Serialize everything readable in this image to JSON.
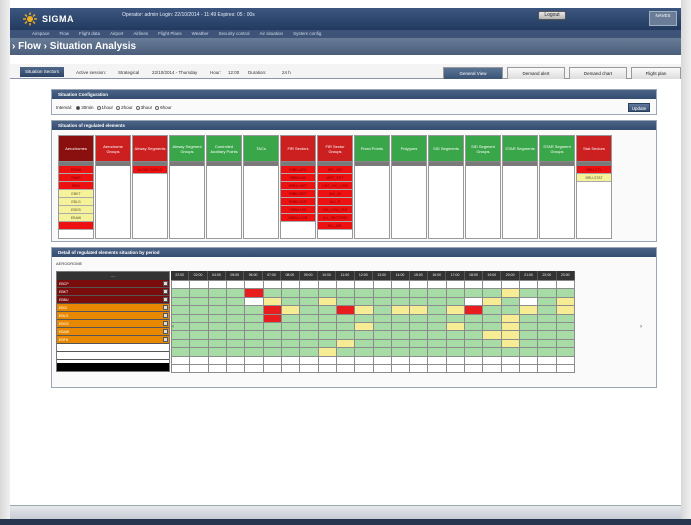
{
  "app": {
    "name": "SIGMA",
    "brand": "NAVES"
  },
  "session": {
    "text": "Operator: admin  Login: 22/10/2014 - 11:49  Expires: 05 : 00s"
  },
  "topbar": {
    "logout": "Logout"
  },
  "menu": [
    "Airspace",
    "Flow",
    "Flight data",
    "Airport",
    "Airlines",
    "Flight Plans",
    "Weather",
    "Security control",
    "Air situation",
    "System config"
  ],
  "page_title": "› Flow › Situation Analysis",
  "context": {
    "button": "Situation Sectors",
    "items": [
      "Active session:",
      "Strategical",
      "22/10/2014 - Thursday",
      "Hour:",
      "12:00",
      "Duration:",
      "24 h"
    ]
  },
  "tabs": [
    {
      "label": "General View",
      "active": true
    },
    {
      "label": "Demand alert",
      "active": false
    },
    {
      "label": "Demand chart",
      "active": false
    },
    {
      "label": "Flight plan",
      "active": false
    }
  ],
  "config": {
    "title": "Situation Configuration",
    "interval_label": "Interval:",
    "options": [
      {
        "label": "30min",
        "selected": true
      },
      {
        "label": "1hour",
        "selected": false
      },
      {
        "label": "2hour",
        "selected": false
      },
      {
        "label": "3hour",
        "selected": false
      },
      {
        "label": "6hour",
        "selected": false
      }
    ],
    "update": "Update"
  },
  "regulated": {
    "title": "Situation of regulated elements",
    "columns": [
      {
        "label": "Aerodromes",
        "color": "dred",
        "cells": [
          [
            "EBAW",
            "cr"
          ],
          [
            "EBAP",
            "cr"
          ],
          [
            "EBCI",
            "cr"
          ],
          [
            "EBKT",
            "cy"
          ],
          [
            "EBLG",
            "cy"
          ],
          [
            "EBOS",
            "cy"
          ],
          [
            "EBAW",
            "cy"
          ],
          [
            "",
            "cr"
          ]
        ]
      },
      {
        "label": "Aerodrome Groups",
        "color": "red",
        "cells": []
      },
      {
        "label": "Airway Segments",
        "color": "red",
        "cells": [
          [
            "ALGAT-GOSLO",
            "cr"
          ]
        ]
      },
      {
        "label": "Airway Segment Groups",
        "color": "grn",
        "cells": []
      },
      {
        "label": "Controlled Auxiliary Points",
        "color": "grn",
        "cells": []
      },
      {
        "label": "TACs",
        "color": "grn",
        "cells": []
      },
      {
        "label": "FIR Sectors",
        "color": "red",
        "cells": [
          [
            "EBBU-ARL",
            "cr"
          ],
          [
            "EBBU-NIC",
            "cr"
          ],
          [
            "EBBU-WST",
            "cr"
          ],
          [
            "EBBU-EST",
            "cr"
          ],
          [
            "EBBU-CNT",
            "cr"
          ],
          [
            "EBBU-HIG",
            "cr"
          ],
          [
            "EBBU-LOW",
            "cr"
          ]
        ]
      },
      {
        "label": "FIR Sector Groups",
        "color": "red",
        "cells": [
          [
            "ARL_NIC",
            "cr"
          ],
          [
            "WST_EST",
            "cr"
          ],
          [
            "CNT_HIG_LOW",
            "cr"
          ],
          [
            "ALL_W",
            "cr"
          ],
          [
            "ALL_E",
            "cr"
          ],
          [
            "HIG_LOW_CNT",
            "cr"
          ],
          [
            "ALL_SECTORS",
            "cr"
          ],
          [
            "NIC_ARL",
            "cr"
          ]
        ]
      },
      {
        "label": "Fixed Points",
        "color": "grn",
        "cells": []
      },
      {
        "label": "Polygons",
        "color": "grn",
        "cells": []
      },
      {
        "label": "SID Segments",
        "color": "grn",
        "cells": []
      },
      {
        "label": "SID Segment Groups",
        "color": "grn",
        "cells": []
      },
      {
        "label": "STAR Segments",
        "color": "grn",
        "cells": []
      },
      {
        "label": "STAR Segment Groups",
        "color": "grn",
        "cells": []
      },
      {
        "label": "Stat Sectors",
        "color": "red",
        "cells": [
          [
            "BRU-CTL",
            "cr"
          ],
          [
            "BRU-STAT",
            "cy"
          ]
        ]
      }
    ]
  },
  "detail": {
    "title": "Detail of regulated elements situation by period",
    "subtitle": "AERODROME",
    "group_header": "---",
    "times": [
      "22:00",
      "02:00",
      "04:00",
      "05:00",
      "06:00",
      "07:00",
      "08:00",
      "09:00",
      "10:00",
      "11:00",
      "12:00",
      "13:00",
      "14:00",
      "15:00",
      "16:00",
      "17:00",
      "18:00",
      "19:00",
      "20:00",
      "21:00",
      "22:00",
      "23:00"
    ],
    "rows": [
      {
        "name": "EBCP",
        "bg": "#7a0c0c"
      },
      {
        "name": "EBKT",
        "bg": "#7a0c0c"
      },
      {
        "name": "EBBU",
        "bg": "#7a0c0c"
      },
      {
        "name": "EBCI",
        "bg": "#e88800"
      },
      {
        "name": "EBLG",
        "bg": "#e88800"
      },
      {
        "name": "EBOS",
        "bg": "#e88800"
      },
      {
        "name": "EBAW",
        "bg": "#e88800"
      },
      {
        "name": "EBFN",
        "bg": "#e88800"
      },
      {
        "name": "",
        "bg": "#ffffff"
      },
      {
        "name": "",
        "bg": "#ffffff"
      }
    ],
    "grid": [
      "wwwwwwwwwwwwwwwwwwwwww",
      "ggggrgggggggggggggyggg",
      "ggggwyggygggggggwygwgy",
      "gggggryggrygyygyrggygy",
      "gggggrggggggggggggygg",
      "ggggggggggyggggyggyggg",
      "gggggggggggggggggyyggg",
      "gggggggggyggggggggyggg",
      "ggggggggyggggggggggggg",
      "wwwwwwwwwwwwwwwwwwwwww",
      "wwwwwwwwwwwwwwwwwwwwww"
    ]
  }
}
